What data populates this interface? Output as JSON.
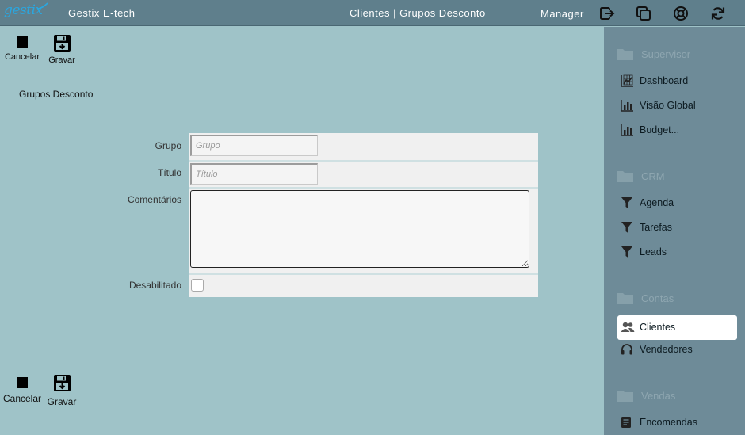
{
  "header": {
    "logo_text": "gestix",
    "app_title": "Gestix E-tech",
    "page_title": "Clientes | Grupos Desconto",
    "user": "Manager",
    "icons": [
      "logout-icon",
      "windows-icon",
      "help-icon",
      "refresh-icon"
    ]
  },
  "toolbar": {
    "cancel_label": "Cancelar",
    "save_label": "Gravar"
  },
  "section_title": "Grupos Desconto",
  "form": {
    "grupo": {
      "label": "Grupo",
      "placeholder": "Grupo",
      "value": ""
    },
    "titulo": {
      "label": "Título",
      "placeholder": "Título",
      "value": ""
    },
    "comentarios": {
      "label": "Comentários",
      "value": ""
    },
    "desabilitado": {
      "label": "Desabilitado",
      "checked": false
    }
  },
  "sidebar": {
    "groups": [
      {
        "title": "Supervisor",
        "items": [
          {
            "label": "Dashboard",
            "icon": "dashboard-chart-icon"
          },
          {
            "label": "Visão Global",
            "icon": "bar-chart-icon"
          },
          {
            "label": "Budget...",
            "icon": "bar-chart-icon"
          }
        ]
      },
      {
        "title": "CRM",
        "items": [
          {
            "label": "Agenda",
            "icon": "funnel-icon"
          },
          {
            "label": "Tarefas",
            "icon": "funnel-icon"
          },
          {
            "label": "Leads",
            "icon": "funnel-icon"
          }
        ]
      },
      {
        "title": "Contas",
        "items": [
          {
            "label": "Clientes",
            "icon": "users-icon",
            "active": true
          },
          {
            "label": "Vendedores",
            "icon": "headset-icon"
          }
        ]
      },
      {
        "title": "Vendas",
        "items": [
          {
            "label": "Encomendas",
            "icon": "document-icon"
          }
        ]
      }
    ]
  },
  "colors": {
    "background": "#9fc3c8",
    "topbar": "#5f7f8c",
    "sidebar": "#6e8b98",
    "logo": "#2aa7e0"
  }
}
